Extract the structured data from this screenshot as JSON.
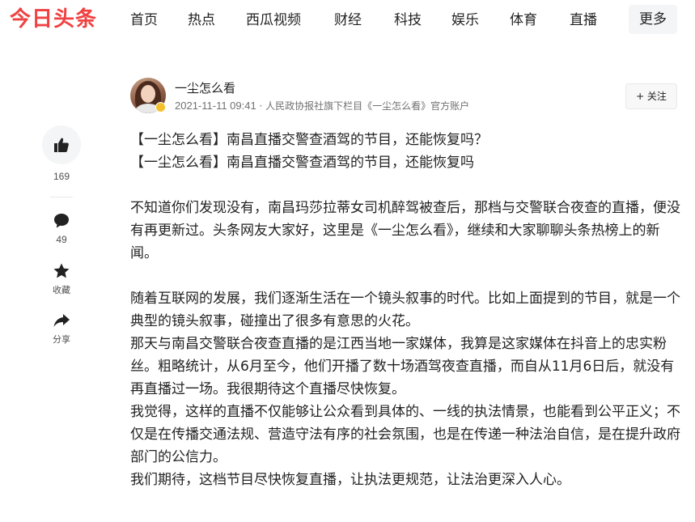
{
  "header": {
    "logo": "今日头条",
    "nav": [
      "首页",
      "热点",
      "西瓜视频",
      "财经",
      "科技",
      "娱乐",
      "体育",
      "直播"
    ],
    "more": "更多"
  },
  "author": {
    "name": "一尘怎么看",
    "time": "2021-11-11 09:41",
    "meta": " · 人民政协报社旗下栏目《一尘怎么看》官方账户",
    "follow": "+ 关注"
  },
  "rail": {
    "like_count": "169",
    "comment_count": "49",
    "favorite_label": "收藏",
    "share_label": "分享"
  },
  "article": {
    "title_lines": [
      "【一尘怎么看】南昌直播交警查酒驾的节目，还能恢复吗？",
      "【一尘怎么看】南昌直播交警查酒驾的节目，还能恢复吗"
    ],
    "intro": "不知道你们发现没有，南昌玛莎拉蒂女司机醉驾被查后，那档与交警联合夜查的直播，便没有再更新过。头条网友大家好，这里是《一尘怎么看》，继续和大家聊聊头条热榜上的新闻。",
    "paragraphs": [
      "随着互联网的发展，我们逐渐生活在一个镜头叙事的时代。比如上面提到的节目，就是一个典型的镜头叙事，碰撞出了很多有意思的火花。",
      "那天与南昌交警联合夜查直播的是江西当地一家媒体，我算是这家媒体在抖音上的忠实粉丝。粗略统计，从6月至今，他们开播了数十场酒驾夜查直播，而自从11月6日后，就没有再直播过一场。我很期待这个直播尽快恢复。",
      "我觉得，这样的直播不仅能够让公众看到具体的、一线的执法情景，也能看到公平正义；不仅是在传播交通法规、营造守法有序的社会氛围，也是在传递一种法治自信，是在提升政府部门的公信力。",
      "我们期待，这档节目尽快恢复直播，让执法更规范，让法治更深入人心。"
    ]
  },
  "colors": {
    "brand": "#f04142",
    "text": "#222222",
    "muted": "#707070",
    "rail_bg": "#f4f5f6"
  }
}
